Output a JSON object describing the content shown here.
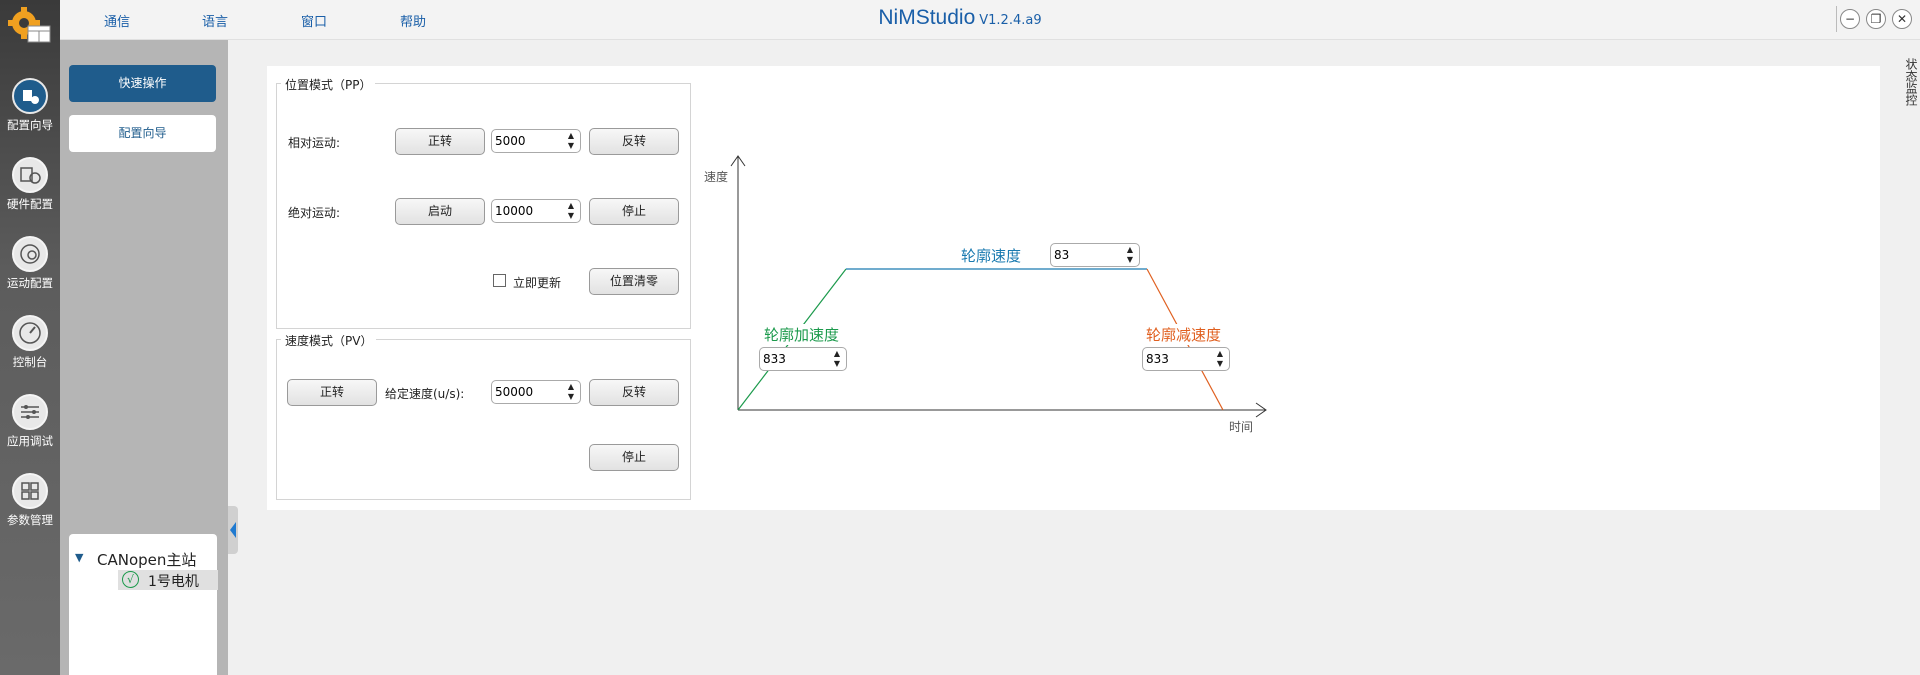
{
  "menu": [
    "通信",
    "语言",
    "窗口",
    "帮助"
  ],
  "app": {
    "name": "NiMStudio",
    "version": "V1.2.4.a9"
  },
  "window_controls": {
    "minimize": "−",
    "restore": "❐",
    "close": "✕"
  },
  "nav": [
    "配置向导",
    "硬件配置",
    "运动配置",
    "控制台",
    "应用调试",
    "参数管理"
  ],
  "sub": {
    "quick": "快速操作",
    "wizard": "配置向导"
  },
  "tree": {
    "root": "CANopen主站",
    "child": "1号电机",
    "child_check": "√"
  },
  "right_strip": {
    "label": "状态监控"
  },
  "pp": {
    "title": "位置模式（PP）",
    "relative_label": "相对运动:",
    "forward": "正转",
    "relative_value": "5000",
    "reverse": "反转",
    "absolute_label": "绝对运动:",
    "start": "启动",
    "absolute_value": "10000",
    "stop": "停止",
    "immediate_update": "立即更新",
    "zero": "位置清零"
  },
  "pv": {
    "title": "速度模式（PV）",
    "forward": "正转",
    "speed_label": "给定速度(u/s):",
    "speed_value": "50000",
    "reverse": "反转",
    "stop": "停止"
  },
  "chart": {
    "y_label": "速度",
    "x_label": "时间",
    "velocity_label": "轮廓速度",
    "velocity_value": "83",
    "accel_label": "轮廓加速度",
    "accel_value": "833",
    "decel_label": "轮廓减速度",
    "decel_value": "833"
  },
  "colors": {
    "accent": "#1f5c8c",
    "velocity": "#1a7ab0",
    "accel": "#1c9a4c",
    "decel": "#e06020"
  }
}
